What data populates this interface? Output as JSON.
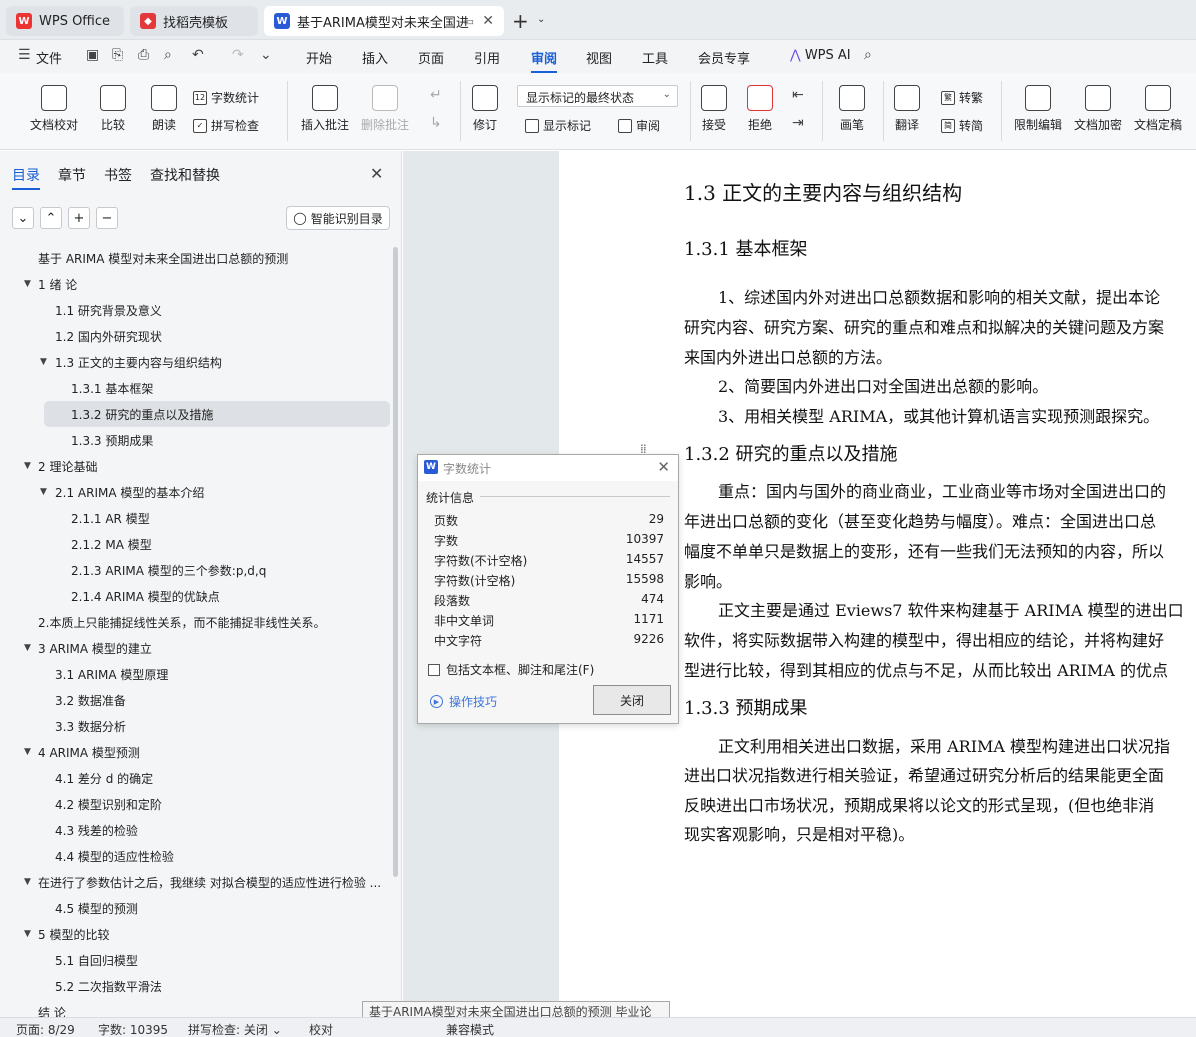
{
  "tabs": {
    "wps_office": "WPS Office",
    "templates": "找稻壳模板",
    "document": "基于ARIMA模型对未来全国进"
  },
  "menu": {
    "file": "文件",
    "items": [
      "开始",
      "插入",
      "页面",
      "引用",
      "审阅",
      "视图",
      "工具",
      "会员专享"
    ],
    "active": "审阅",
    "wps_ai": "WPS AI"
  },
  "ribbon": {
    "doc_check": "文档校对",
    "compare": "比较",
    "read_aloud": "朗读",
    "word_count": "字数统计",
    "spell_check": "拼写检查",
    "insert_comment": "插入批注",
    "delete_comment": "删除批注",
    "revise": "修订",
    "markup_state": "显示标记的最终状态",
    "show_markup": "显示标记",
    "review": "审阅",
    "accept": "接受",
    "reject": "拒绝",
    "pen": "画笔",
    "translate": "翻译",
    "to_traditional": "转繁",
    "to_simplified": "转简",
    "restrict_edit": "限制编辑",
    "encrypt": "文档加密",
    "finalize": "文档定稿"
  },
  "nav": {
    "tabs": [
      "目录",
      "章节",
      "书签",
      "查找和替换"
    ],
    "smart_toc": "智能识别目录",
    "toc": [
      {
        "text": "基于 ARIMA 模型对未来全国进出口总额的预测",
        "level": 0,
        "arrow": false
      },
      {
        "text": "1  绪  论",
        "level": 0,
        "arrow": true
      },
      {
        "text": "1.1 研究背景及意义",
        "level": 1,
        "arrow": false
      },
      {
        "text": "1.2 国内外研究现状",
        "level": 1,
        "arrow": false
      },
      {
        "text": "1.3  正文的主要内容与组织结构",
        "level": 1,
        "arrow": true
      },
      {
        "text": "1.3.1  基本框架",
        "level": 2,
        "arrow": false
      },
      {
        "text": "1.3.2  研究的重点以及措施",
        "level": 2,
        "arrow": false,
        "selected": true
      },
      {
        "text": "1.3.3 预期成果",
        "level": 2,
        "arrow": false
      },
      {
        "text": "2    理论基础",
        "level": 0,
        "arrow": true
      },
      {
        "text": "2.1 ARIMA 模型的基本介绍",
        "level": 1,
        "arrow": true
      },
      {
        "text": "2.1.1 AR 模型",
        "level": 2,
        "arrow": false
      },
      {
        "text": "2.1.2    MA 模型",
        "level": 2,
        "arrow": false
      },
      {
        "text": "2.1.3    ARIMA 模型的三个参数:p,d,q",
        "level": 2,
        "arrow": false
      },
      {
        "text": "2.1.4    ARIMA 模型的优缺点",
        "level": 2,
        "arrow": false
      },
      {
        "text": "2.本质上只能捕捉线性关系，而不能捕捉非线性关系。",
        "level": 0,
        "arrow": false
      },
      {
        "text": "3 ARIMA 模型的建立",
        "level": 0,
        "arrow": true
      },
      {
        "text": "3.1 ARIMA 模型原理",
        "level": 1,
        "arrow": false
      },
      {
        "text": "3.2  数据准备",
        "level": 1,
        "arrow": false
      },
      {
        "text": "3.3  数据分析",
        "level": 1,
        "arrow": false
      },
      {
        "text": "4 ARIMA 模型预测",
        "level": 0,
        "arrow": true
      },
      {
        "text": "4.1  差分 d 的确定",
        "level": 1,
        "arrow": false
      },
      {
        "text": "4.2 模型识别和定阶",
        "level": 1,
        "arrow": false
      },
      {
        "text": "4.3  残差的检验",
        "level": 1,
        "arrow": false
      },
      {
        "text": "4.4 模型的适应性检验",
        "level": 1,
        "arrow": false
      },
      {
        "text": "在进行了参数估计之后，我继续  对拟合模型的适应性进行检验 ...",
        "level": 0,
        "arrow": true
      },
      {
        "text": "4.5 模型的预测",
        "level": 1,
        "arrow": false
      },
      {
        "text": "5  模型的比较",
        "level": 0,
        "arrow": true
      },
      {
        "text": "5.1 自回归模型",
        "level": 1,
        "arrow": false
      },
      {
        "text": "5.2 二次指数平滑法",
        "level": 1,
        "arrow": false
      },
      {
        "text": "结  论",
        "level": 0,
        "arrow": false
      }
    ]
  },
  "doc": {
    "h_1_3": "1.3  正文的主要内容与组织结构",
    "h_1_3_1": "1.3.1  基本框架",
    "p1_l1": "1、综述国内外对进出口总额数据和影响的相关文献，提出本论",
    "p1_l2": "研究内容、研究方案、研究的重点和难点和拟解决的关键问题及方案",
    "p1_l3": "来国内外进出口总额的方法。",
    "p2": "2、简要国内外进出口对全国进出总额的影响。",
    "p3": "3、用相关模型 ARIMA，或其他计算机语言实现预测跟探究。",
    "h_1_3_2": "1.3.2  研究的重点以及措施",
    "p4_l1": "重点：国内与国外的商业商业，工业商业等市场对全国进出口的",
    "p4_l2": "年进出口总额的变化（甚至变化趋势与幅度）。难点：全国进出口总",
    "p4_l3": "幅度不单单只是数据上的变形，还有一些我们无法预知的内容，所以",
    "p4_l4": "影响。",
    "p5_l1": "正文主要是通过 Eviews7 软件来构建基于 ARIMA 模型的进出口",
    "p5_l2": "软件，将实际数据带入构建的模型中，得出相应的结论，并将构建好",
    "p5_l3": "型进行比较，得到其相应的优点与不足，从而比较出 ARIMA 的优点",
    "h_1_3_3": "1.3.3 预期成果",
    "p6_l1": "正文利用相关进出口数据，采用 ARIMA 模型构建进出口状况指",
    "p6_l2": "进出口状况指数进行相关验证，希望通过研究分析后的结果能更全面",
    "p6_l3": "反映进出口市场状况，预期成果将以论文的形式呈现，(但也绝非消",
    "p6_l4": "现实客观影响，只是相对平稳)。"
  },
  "dialog": {
    "title": "字数统计",
    "section": "统计信息",
    "stats": [
      {
        "label": "页数",
        "value": "29"
      },
      {
        "label": "字数",
        "value": "10397"
      },
      {
        "label": "字符数(不计空格)",
        "value": "14557"
      },
      {
        "label": "字符数(计空格)",
        "value": "15598"
      },
      {
        "label": "段落数",
        "value": "474"
      },
      {
        "label": "非中文单词",
        "value": "1171"
      },
      {
        "label": "中文字符",
        "value": "9226"
      }
    ],
    "checkbox": "包括文本框、脚注和尾注(F)",
    "tips": "操作技巧",
    "close": "关闭"
  },
  "tooltip": "基于ARIMA模型对未来全国进出口总额的预测 毕业论文.docx - WPS Office 兼容模式",
  "status": {
    "page": "页面: 8/29",
    "words": "字数: 10395",
    "spell": "拼写检查: 关闭",
    "proof": "校对",
    "compat": "兼容模式"
  },
  "colors": {
    "accent": "#1a5fd6",
    "doc_bg": "#e3e9ea"
  }
}
